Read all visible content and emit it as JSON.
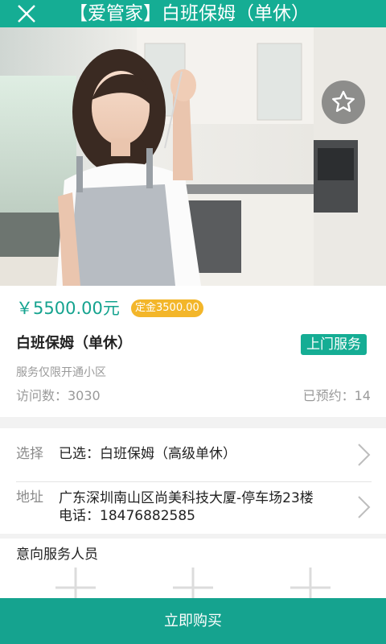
{
  "header": {
    "title": "【爱管家】白班保姆（单休）"
  },
  "product": {
    "price": "￥5500.00元",
    "deposit": "定金3500.00",
    "name": "白班保姆（单休）",
    "service_type": "上门服务",
    "service_area": "服务仅限开通小区",
    "visits": "访问数：3030",
    "booked": "已预约：14"
  },
  "options": {
    "select_label": "选择",
    "select_value": "已选：白班保姆（高级单休）",
    "address_label": "地址",
    "address_line": "广东深圳南山区尚美科技大厦-停车场23楼",
    "phone_line": "电话：18476882585"
  },
  "staff": {
    "title": "意向服务人员"
  },
  "actions": {
    "buy_label": "立即购买"
  },
  "colors": {
    "accent": "#15ad94",
    "deposit": "#f3b62a"
  }
}
